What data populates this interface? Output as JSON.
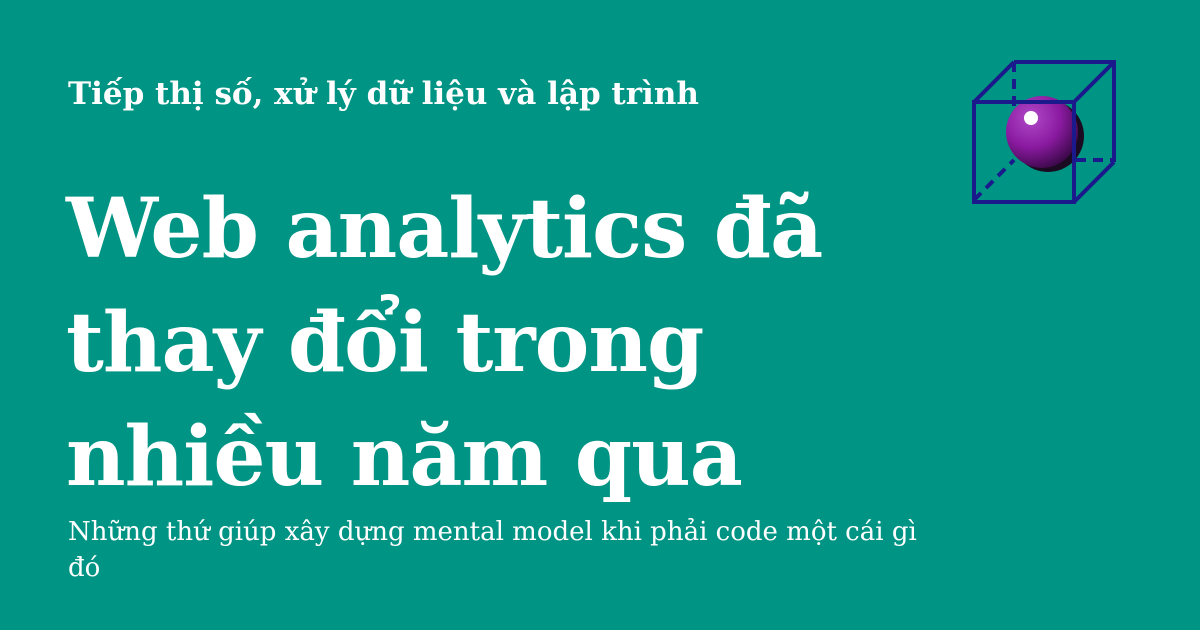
{
  "kicker": "Tiếp thị số, xử lý dữ liệu và lập trình",
  "title": "Web analytics đã thay đổi trong nhiều năm qua",
  "subtitle": "Những thứ giúp xây dựng mental model khi phải code một cái gì đó",
  "logo": {
    "icon": "cube-sphere-logo-icon",
    "cube_color": "#1a1a8c",
    "sphere_color": "#8a1aa0"
  },
  "colors": {
    "background": "#009484",
    "text": "#ffffff"
  }
}
